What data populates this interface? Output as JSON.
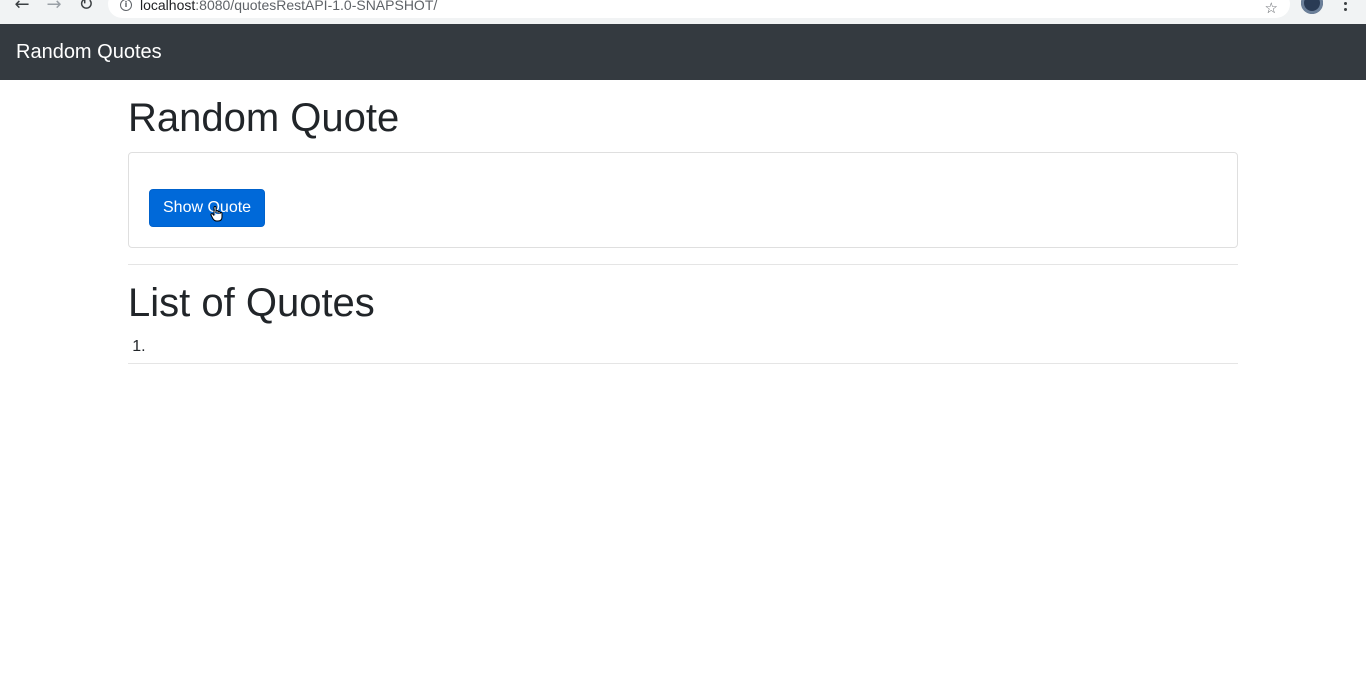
{
  "browser": {
    "url_host": "localhost",
    "url_path": ":8080/quotesRestAPI-1.0-SNAPSHOT/"
  },
  "navbar": {
    "brand": "Random Quotes"
  },
  "random_section": {
    "heading": "Random Quote",
    "button_label": "Show Quote"
  },
  "list_section": {
    "heading": "List of Quotes",
    "items": [
      ""
    ]
  },
  "colors": {
    "navbar_bg": "#343a40",
    "primary": "#0069d9"
  }
}
